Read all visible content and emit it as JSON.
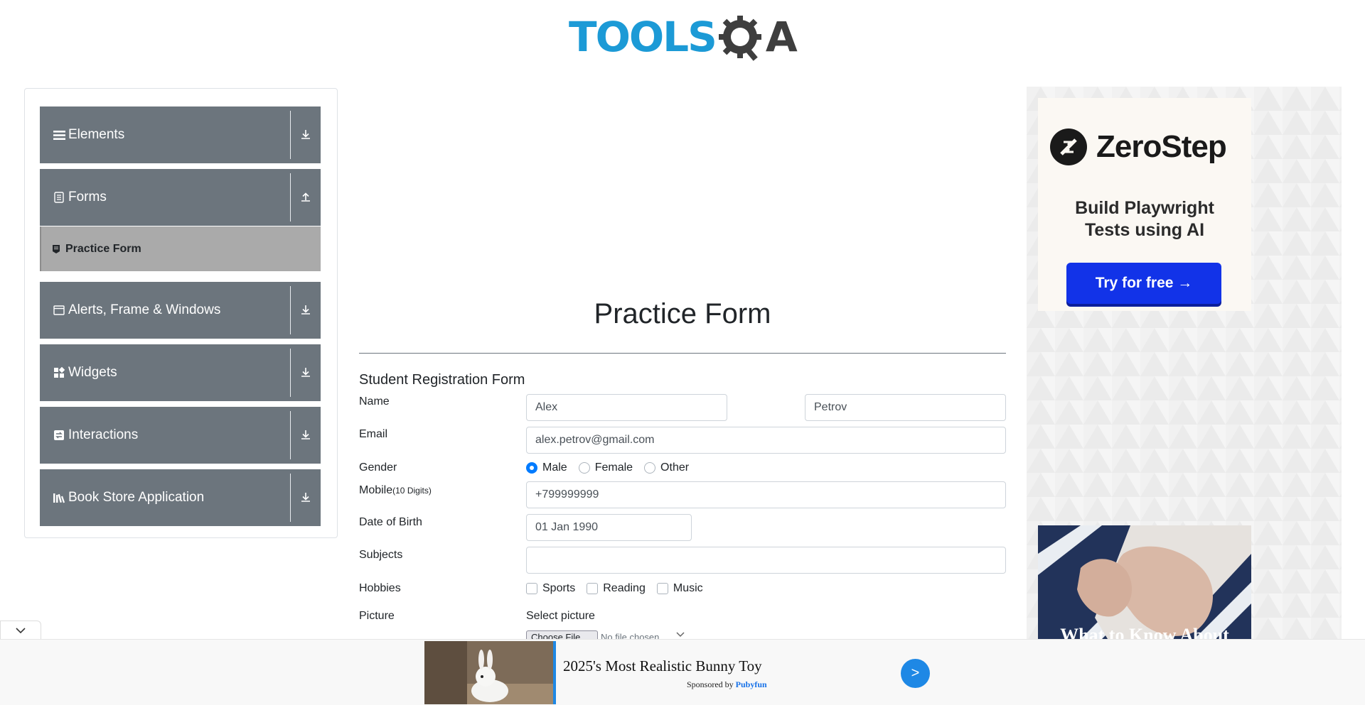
{
  "header": {
    "logo_main": "TOOLS",
    "logo_tail": "A"
  },
  "sidebar": {
    "groups": [
      {
        "label": "Elements",
        "icon": "hamburger-icon",
        "toggle": "download-icon"
      },
      {
        "label": "Forms",
        "icon": "document-icon",
        "toggle": "upload-icon"
      },
      {
        "label": "Alerts, Frame & Windows",
        "icon": "window-icon",
        "toggle": "download-icon"
      },
      {
        "label": "Widgets",
        "icon": "widgets-icon",
        "toggle": "download-icon"
      },
      {
        "label": "Interactions",
        "icon": "interactions-icon",
        "toggle": "download-icon"
      },
      {
        "label": "Book Store Application",
        "icon": "books-icon",
        "toggle": "download-icon"
      }
    ],
    "subitems": [
      {
        "label": "Practice Form",
        "icon": "form-icon",
        "active": true
      }
    ]
  },
  "main": {
    "title": "Practice Form",
    "form_heading": "Student Registration Form",
    "labels": {
      "name": "Name",
      "email": "Email",
      "gender": "Gender",
      "mobile": "Mobile",
      "mobile_hint": "(10 Digits)",
      "dob": "Date of Birth",
      "subjects": "Subjects",
      "hobbies": "Hobbies",
      "picture": "Picture"
    },
    "values": {
      "first_name": "Alex",
      "last_name": "Petrov",
      "email": "alex.petrov@gmail.com",
      "mobile": "+799999999",
      "dob": "01 Jan 1990",
      "subjects": ""
    },
    "gender_options": [
      {
        "label": "Male",
        "checked": true
      },
      {
        "label": "Female",
        "checked": false
      },
      {
        "label": "Other",
        "checked": false
      }
    ],
    "hobby_options": [
      {
        "label": "Sports",
        "checked": false
      },
      {
        "label": "Reading",
        "checked": false
      },
      {
        "label": "Music",
        "checked": false
      }
    ],
    "select_picture": "Select picture",
    "choose_file": "Choose File",
    "no_file": "No file chosen"
  },
  "right_ad": {
    "brand": "ZeroStep",
    "tagline_line1": "Build Playwright",
    "tagline_line2": "Tests using AI",
    "cta": "Try for free →",
    "photo_caption": "What to Know About"
  },
  "bottom_ad": {
    "title": "2025's Most Realistic Bunny Toy",
    "sponsored_prefix": "Sponsored by ",
    "sponsor": "Pubyfun",
    "go": ">"
  },
  "colors": {
    "sidebar_group": "#6c757d",
    "sidebar_active": "#aaaaaa",
    "primary": "#007bff",
    "logo_blue": "#1c9ad6",
    "zerostep_button": "#1233e8"
  }
}
